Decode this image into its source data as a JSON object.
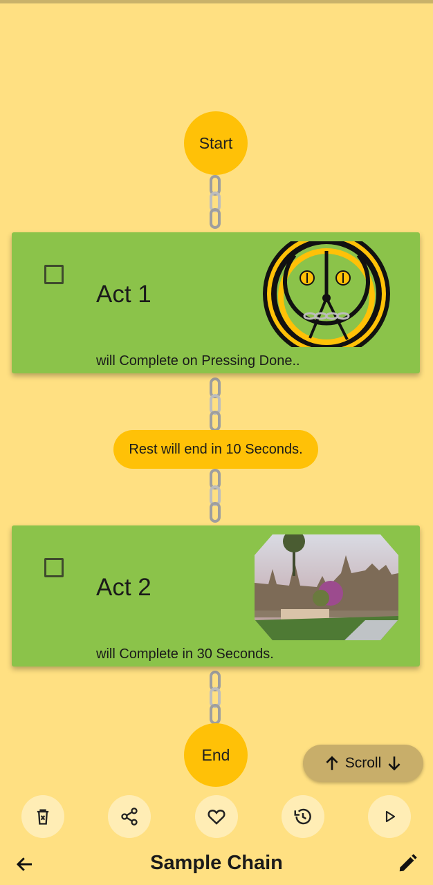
{
  "flow": {
    "start_label": "Start",
    "end_label": "End",
    "rest_label": "Rest will end in 10 Seconds."
  },
  "acts": [
    {
      "title": "Act 1",
      "subtitle": "will Complete on Pressing Done..",
      "checked": false,
      "image_icon": "chain-logo-image"
    },
    {
      "title": "Act 2",
      "subtitle": "will Complete in 30 Seconds.",
      "checked": false,
      "image_icon": "temple-photo-image"
    }
  ],
  "scroll_button": {
    "label": "Scroll",
    "icons": [
      "arrow-up-icon",
      "arrow-down-icon"
    ]
  },
  "toolbar": {
    "icons": [
      "delete-icon",
      "share-icon",
      "heart-icon",
      "history-icon",
      "play-icon"
    ]
  },
  "bottom_bar": {
    "title": "Sample Chain",
    "left_icon": "back-arrow-icon",
    "right_icon": "edit-pencil-icon"
  },
  "colors": {
    "background": "#FFE082",
    "card": "#8BC34A",
    "accent": "#FFC107",
    "toolbar_button": "#FFEDB5",
    "scroll_button": "#C8AE6A"
  }
}
